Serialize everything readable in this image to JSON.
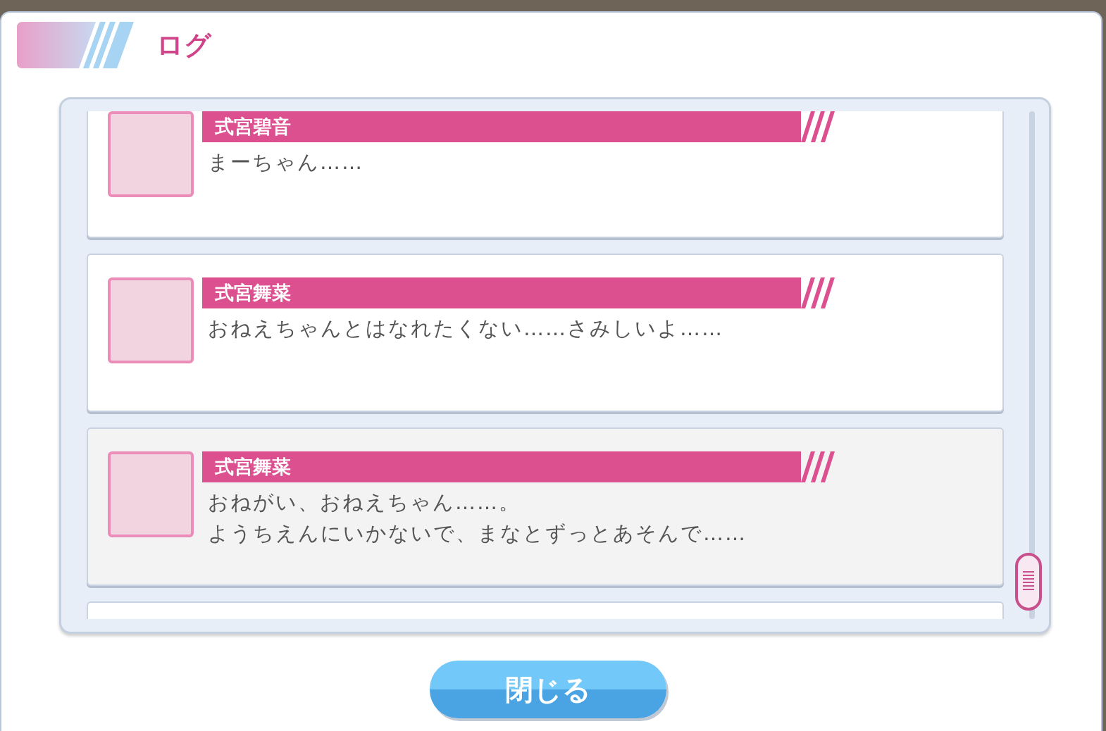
{
  "dialog": {
    "title": "ログ"
  },
  "entries": [
    {
      "speaker": "式宮碧音",
      "lines": [
        "まーちゃん……"
      ],
      "selected": false
    },
    {
      "speaker": "式宮舞菜",
      "lines": [
        "おねえちゃんとはなれたくない……さみしいよ……"
      ],
      "selected": false
    },
    {
      "speaker": "式宮舞菜",
      "lines": [
        "おねがい、おねえちゃん……。",
        "ようちえんにいかないで、まなとずっとあそんで……"
      ],
      "selected": true
    }
  ],
  "close_button": {
    "label": "閉じる"
  }
}
